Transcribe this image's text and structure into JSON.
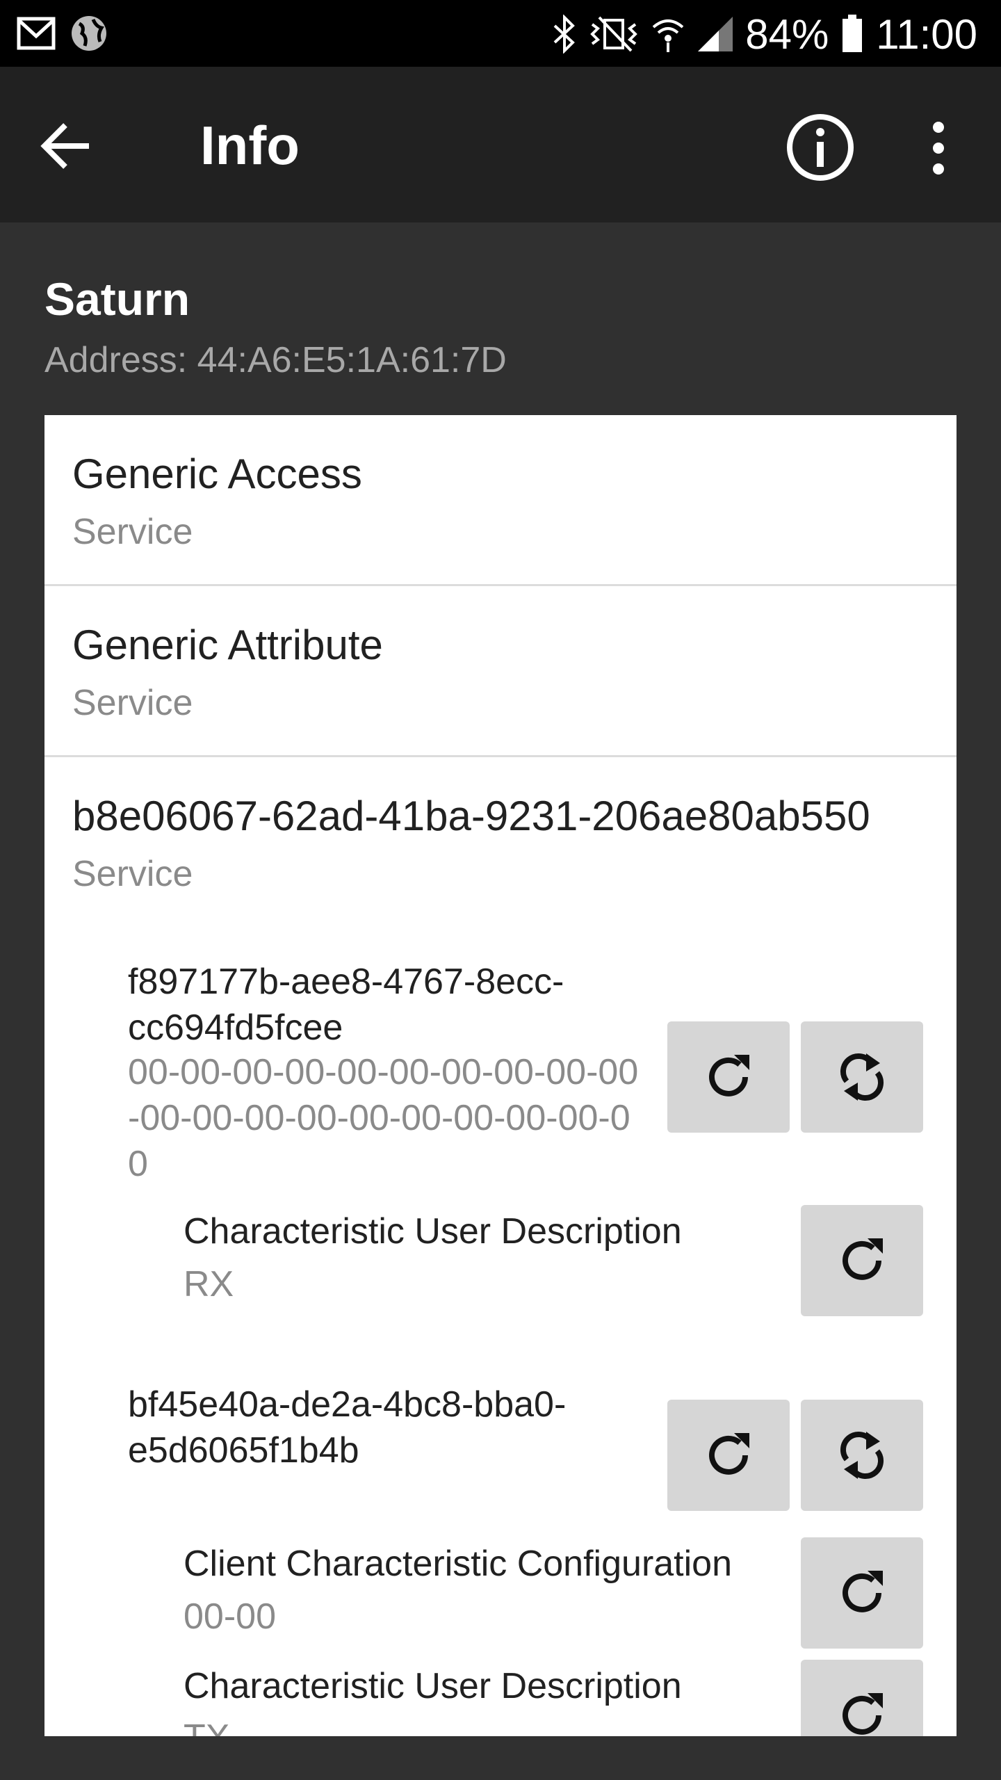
{
  "status_bar": {
    "battery": "84%",
    "time": "11:00",
    "icons": [
      "mail-icon",
      "globe-icon",
      "bluetooth-icon",
      "vibrate-icon",
      "wifi-icon",
      "signal-icon",
      "battery-icon"
    ]
  },
  "app_bar": {
    "title": "Info",
    "icons": [
      "back-arrow-icon",
      "info-icon",
      "more-vert-icon"
    ]
  },
  "device": {
    "name": "Saturn",
    "address": "Address: 44:A6:E5:1A:61:7D"
  },
  "services": [
    {
      "name": "Generic Access",
      "type": "Service"
    },
    {
      "name": "Generic Attribute",
      "type": "Service"
    },
    {
      "name": "b8e06067-62ad-41ba-9231-206ae80ab550",
      "type": "Service",
      "characteristics": [
        {
          "uuid_line1": "f897177b-aee8-4767-8ecc-",
          "uuid_line2": "cc694fd5fcee",
          "value_line1": "00-00-00-00-00-00-00-00-00-00",
          "value_line2": "-00-00-00-00-00-00-00-00-00-0",
          "value_line3": "0",
          "descriptors": [
            {
              "name": "Characteristic User Description",
              "value": "RX"
            }
          ]
        },
        {
          "uuid_line1": "bf45e40a-de2a-4bc8-bba0-",
          "uuid_line2": "e5d6065f1b4b",
          "descriptors": [
            {
              "name": "Client Characteristic Configuration",
              "value": "00-00"
            },
            {
              "name": "Characteristic User Description",
              "value": "TX"
            }
          ]
        }
      ]
    }
  ],
  "colors": {
    "background": "#303030",
    "app_bar": "#212121",
    "status_bar": "#000000",
    "card": "#ffffff",
    "button": "#d6d6d6"
  }
}
